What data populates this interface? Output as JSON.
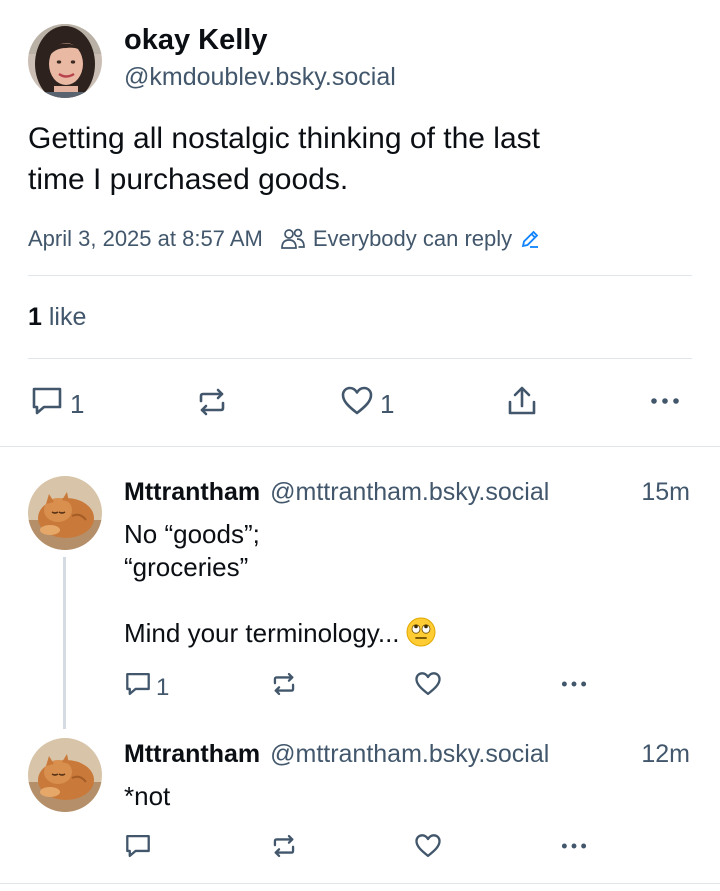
{
  "post": {
    "display_name": "okay Kelly",
    "handle": "@kmdoublev.bsky.social",
    "text": "Getting all nostalgic thinking of the last\ntime I purchased goods.",
    "timestamp": "April 3, 2025 at 8:57 AM",
    "reply_setting": "Everybody can reply",
    "likes_count": "1",
    "likes_label": "like",
    "actions": {
      "reply_count": "1",
      "like_count": "1"
    }
  },
  "replies": [
    {
      "display_name": "Mttrantham",
      "handle": "@mttrantham.bsky.social",
      "time": "15m",
      "text_main": "No “goods”;\n“groceries”\n\nMind your terminology...",
      "emoji": "face-with-rolling-eyes",
      "reply_count": "1"
    },
    {
      "display_name": "Mttrantham",
      "handle": "@mttrantham.bsky.social",
      "time": "12m",
      "text_main": "*not"
    }
  ],
  "colors": {
    "text_primary": "#0b0f14",
    "text_secondary": "#42576c",
    "divider": "#e1e6eb",
    "accent": "#1083fe"
  }
}
